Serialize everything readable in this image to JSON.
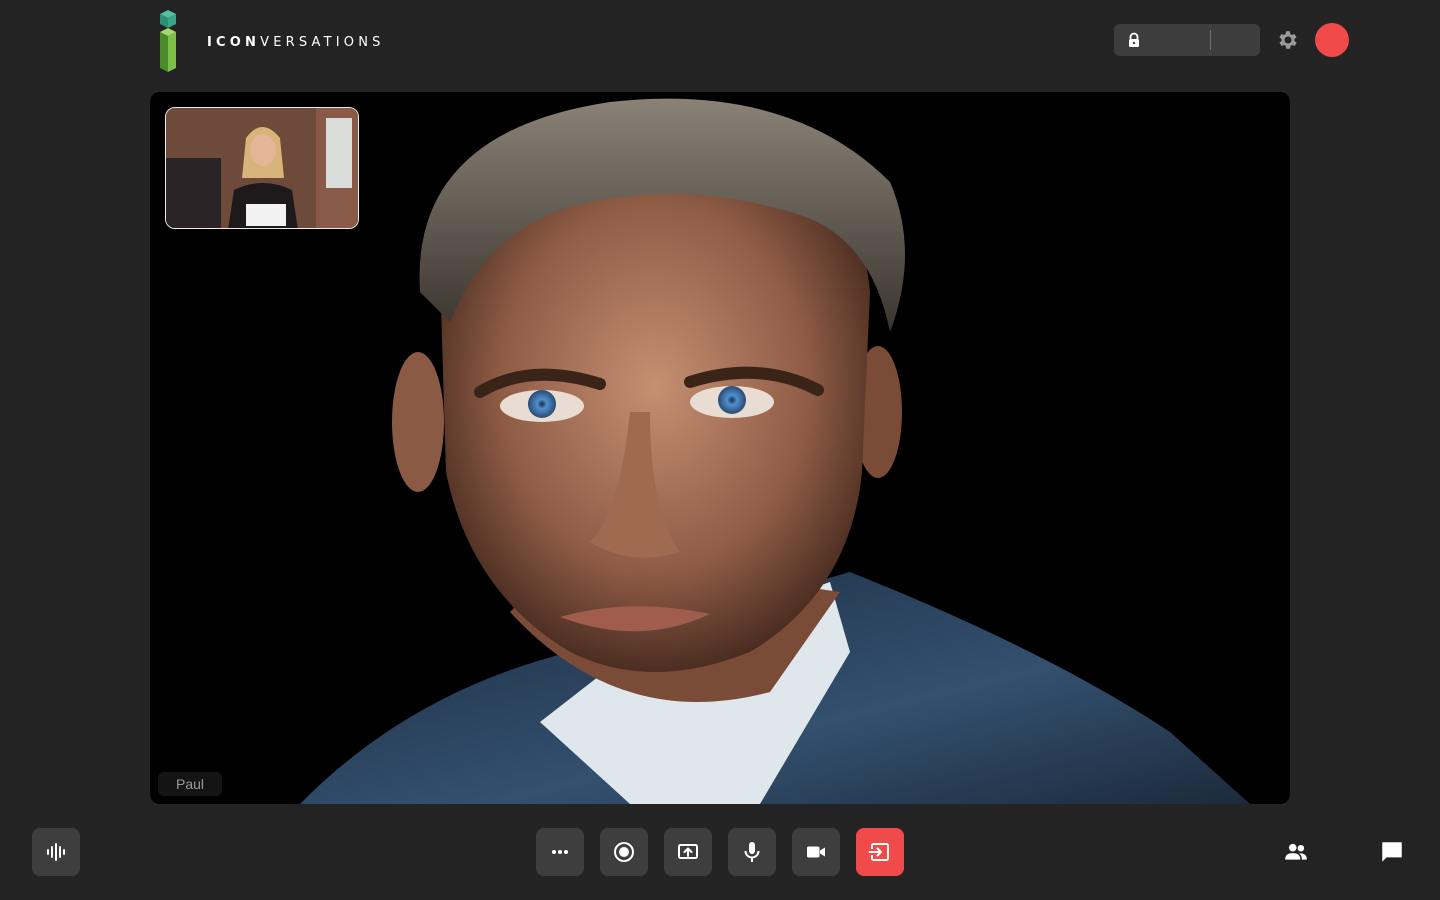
{
  "app": {
    "brand_bold": "ICON",
    "brand_light": "VERSATIONS"
  },
  "header": {
    "room_name": "",
    "room_extra": "",
    "avatar_color": "#f04a4a"
  },
  "main_video": {
    "participant_name": "Paul"
  },
  "controls": {
    "more": "more-options",
    "record": "record",
    "share": "share-screen",
    "mic": "microphone",
    "camera": "camera",
    "leave": "leave-call",
    "leave_color": "#f04a4a"
  },
  "side_controls": {
    "audio": "audio-waveform",
    "participants": "participants",
    "chat": "chat"
  }
}
